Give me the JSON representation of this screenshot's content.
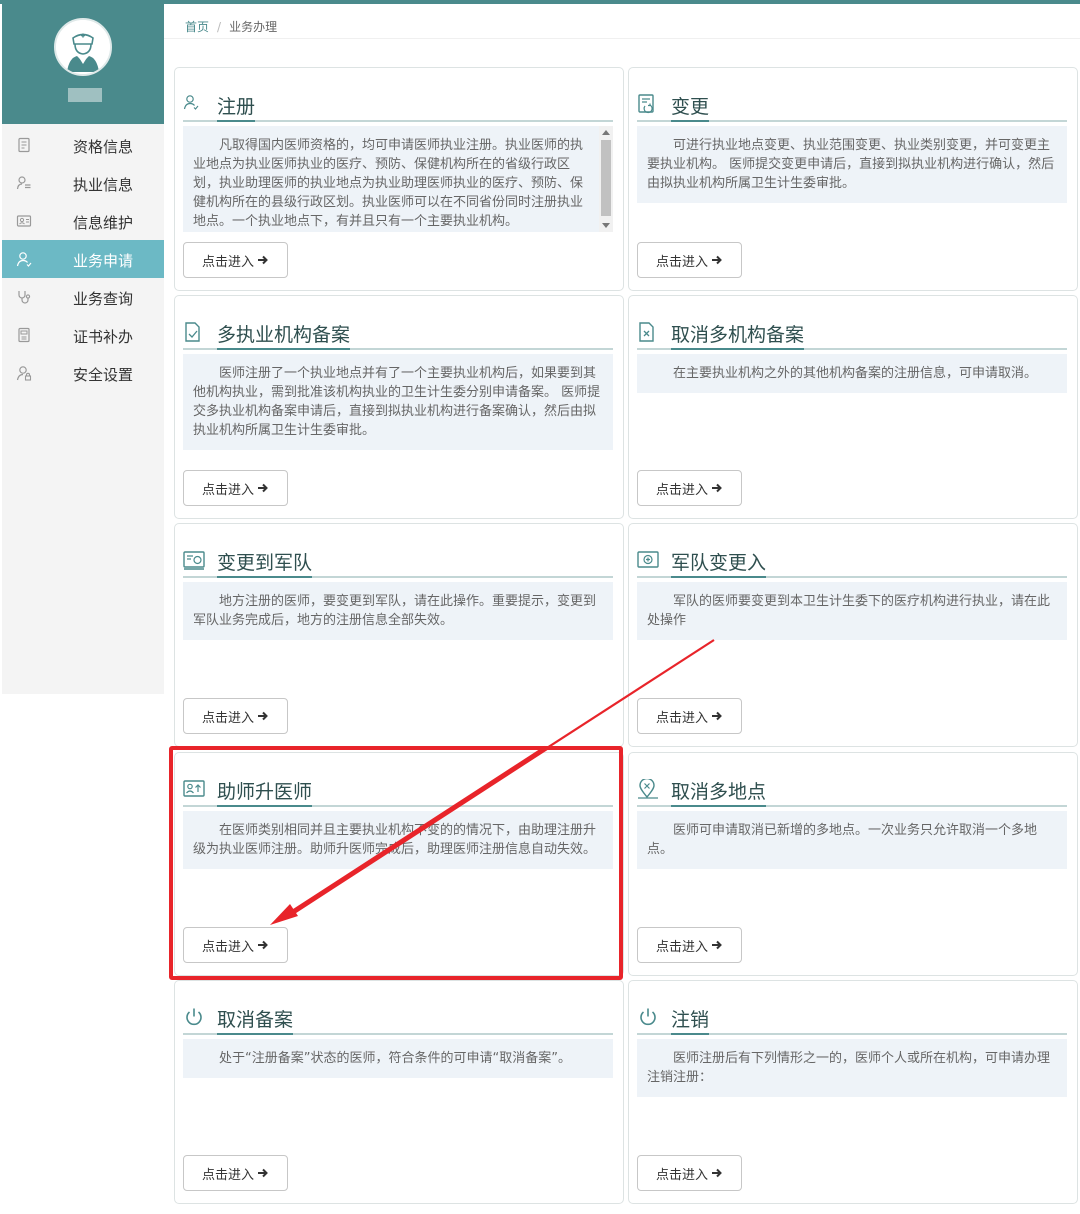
{
  "breadcrumb": {
    "home": "首页",
    "current": "业务办理"
  },
  "sidebar": {
    "items": [
      {
        "label": "资格信息",
        "icon": "document-icon",
        "active": false
      },
      {
        "label": "执业信息",
        "icon": "user-list-icon",
        "active": false
      },
      {
        "label": "信息维护",
        "icon": "id-card-icon",
        "active": false
      },
      {
        "label": "业务申请",
        "icon": "user-icon",
        "active": true
      },
      {
        "label": "业务查询",
        "icon": "stethoscope-icon",
        "active": false
      },
      {
        "label": "证书补办",
        "icon": "certificate-icon",
        "active": false
      },
      {
        "label": "安全设置",
        "icon": "user-lock-icon",
        "active": false
      }
    ]
  },
  "cards": [
    {
      "title": "注册",
      "icon": "user-icon",
      "desc": "凡取得国内医师资格的，均可申请医师执业注册。执业医师的执业地点为执业医师执业的医疗、预防、保健机构所在的省级行政区划，执业助理医师的执业地点为执业助理医师执业的医疗、预防、保健机构所在的县级行政区划。执业医师可以在不同省份同时注册执业地点。一个执业地点下，有并且只有一个主要执业机构。",
      "button": "点击进入"
    },
    {
      "title": "变更",
      "icon": "change-document-icon",
      "desc": "可进行执业地点变更、执业范围变更、执业类别变更，并可变更主要执业机构。 医师提交变更申请后，直接到拟执业机构进行确认，然后由拟执业机构所属卫生计生委审批。",
      "button": "点击进入"
    },
    {
      "title": "多执业机构备案",
      "icon": "document-check-icon",
      "desc": "医师注册了一个执业地点并有了一个主要执业机构后，如果要到其他机构执业，需到批准该机构执业的卫生计生委分别申请备案。 医师提交多执业机构备案申请后，直接到拟执业机构进行备案确认，然后由拟执业机构所属卫生计生委审批。",
      "button": "点击进入"
    },
    {
      "title": "取消多机构备案",
      "icon": "document-cancel-icon",
      "desc": "在主要执业机构之外的其他机构备案的注册信息，可申请取消。",
      "button": "点击进入"
    },
    {
      "title": "变更到军队",
      "icon": "transfer-out-icon",
      "desc": "地方注册的医师，要变更到军队，请在此操作。重要提示，变更到军队业务完成后，地方的注册信息全部失效。",
      "button": "点击进入"
    },
    {
      "title": "军队变更入",
      "icon": "transfer-in-icon",
      "desc": "军队的医师要变更到本卫生计生委下的医疗机构进行执业，请在此处操作",
      "button": "点击进入"
    },
    {
      "title": "助师升医师",
      "icon": "upgrade-icon",
      "desc": "在医师类别相同并且主要执业机构不变的的情况下，由助理注册升级为执业医师注册。助师升医师完成后，助理医师注册信息自动失效。",
      "button": "点击进入"
    },
    {
      "title": "取消多地点",
      "icon": "location-cancel-icon",
      "desc": "医师可申请取消已新增的多地点。一次业务只允许取消一个多地点。",
      "button": "点击进入"
    },
    {
      "title": "取消备案",
      "icon": "power-icon",
      "desc": "处于“注册备案”状态的医师，符合条件的可申请“取消备案”。",
      "button": "点击进入"
    },
    {
      "title": "注销",
      "icon": "power-icon",
      "desc": "医师注册后有下列情形之一的，医师个人或所在机构，可申请办理注销注册：",
      "button": "点击进入"
    }
  ],
  "colors": {
    "brand": "#4a8a8c",
    "active_nav": "#6cb9c5",
    "annotation": "#e8242a"
  }
}
